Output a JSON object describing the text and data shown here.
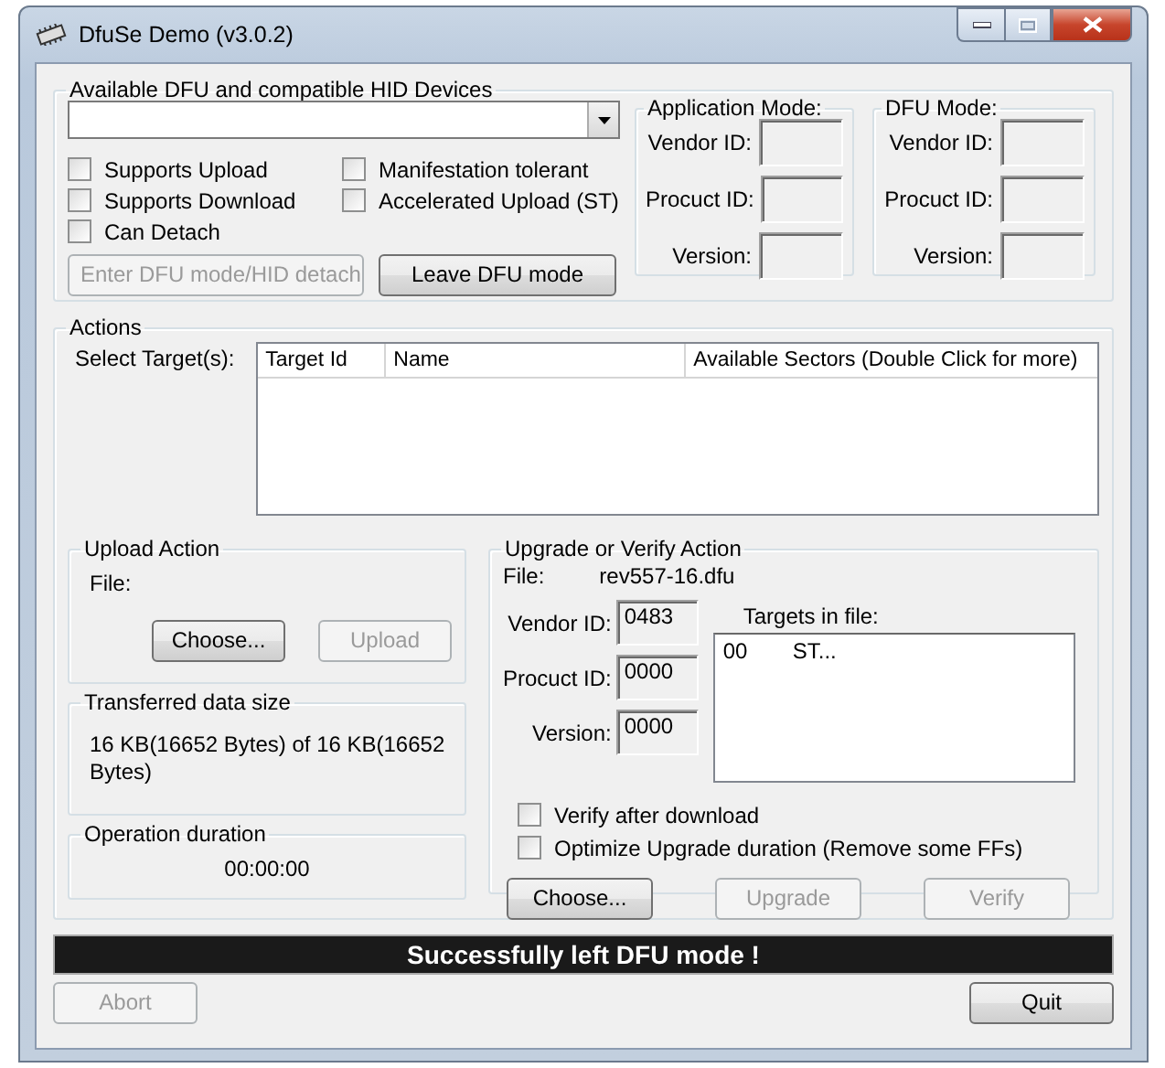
{
  "window": {
    "title": "DfuSe Demo (v3.0.2)"
  },
  "devices": {
    "title": "Available DFU and compatible HID Devices",
    "checkboxes": [
      {
        "label": "Supports Upload",
        "checked": false
      },
      {
        "label": "Manifestation tolerant",
        "checked": false
      },
      {
        "label": "Supports Download",
        "checked": false
      },
      {
        "label": "Accelerated Upload (ST)",
        "checked": false
      },
      {
        "label": "Can Detach",
        "checked": false
      }
    ],
    "buttons": [
      {
        "label": "Enter DFU mode/HID detach",
        "disabled": true
      },
      {
        "label": "Leave DFU mode",
        "disabled": false
      }
    ],
    "modes": [
      {
        "title": "Application Mode:",
        "fields": [
          {
            "label": "Vendor ID:"
          },
          {
            "label": "Procuct ID:"
          },
          {
            "label": "Version:"
          }
        ]
      },
      {
        "title": "DFU Mode:",
        "fields": [
          {
            "label": "Vendor ID:"
          },
          {
            "label": "Procuct ID:"
          },
          {
            "label": "Version:"
          }
        ]
      }
    ]
  },
  "actions": {
    "title": "Actions",
    "select_label": "Select Target(s):",
    "target_table": {
      "columns": [
        "Target Id",
        "Name",
        "Available Sectors (Double Click for more)"
      ]
    },
    "upload": {
      "title": "Upload Action",
      "file_label": "File:",
      "buttons": [
        {
          "label": "Choose...",
          "disabled": false
        },
        {
          "label": "Upload",
          "disabled": true
        }
      ]
    },
    "transferred": {
      "title": "Transferred data size",
      "text": "16 KB(16652 Bytes) of 16 KB(16652 Bytes)"
    },
    "duration": {
      "title": "Operation duration",
      "text": "00:00:00"
    },
    "upgrade": {
      "title": "Upgrade or Verify Action",
      "file_label": "File:",
      "file_name": "rev557-16.dfu",
      "fields": [
        {
          "label": "Vendor ID:",
          "value": "0483"
        },
        {
          "label": "Procuct ID:",
          "value": "0000"
        },
        {
          "label": "Version:",
          "value": "0000"
        }
      ],
      "targets_label": "Targets in file:",
      "targets": [
        {
          "id": "00",
          "name": "ST..."
        }
      ],
      "checkboxes": [
        {
          "label": "Verify after download",
          "checked": false
        },
        {
          "label": "Optimize Upgrade duration (Remove some FFs)",
          "checked": false
        }
      ],
      "buttons": [
        {
          "label": "Choose...",
          "disabled": false
        },
        {
          "label": "Upgrade",
          "disabled": true
        },
        {
          "label": "Verify",
          "disabled": true
        }
      ]
    }
  },
  "status": "Successfully left DFU mode !",
  "footer_buttons": [
    {
      "label": "Abort",
      "disabled": true
    },
    {
      "label": "Quit",
      "disabled": false
    }
  ]
}
